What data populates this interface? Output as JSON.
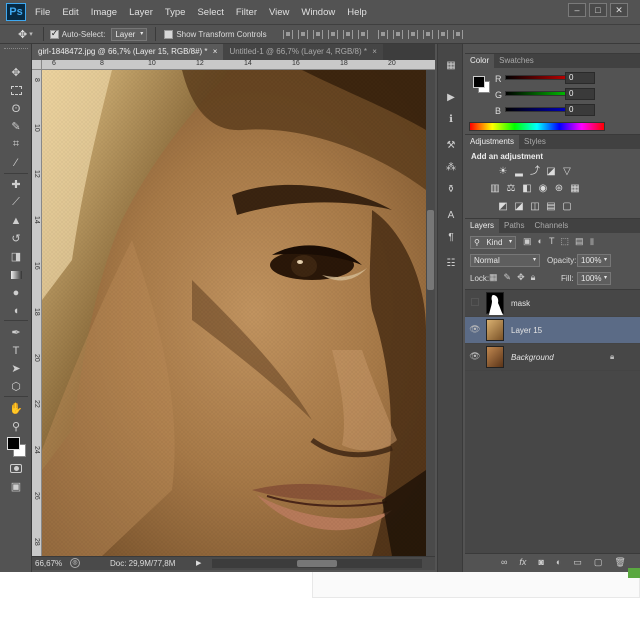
{
  "app": {
    "logo": "Ps",
    "menus": [
      "File",
      "Edit",
      "Image",
      "Layer",
      "Type",
      "Select",
      "Filter",
      "View",
      "Window",
      "Help"
    ],
    "window_controls": {
      "minimize": "–",
      "restore": "□",
      "close": "✕"
    }
  },
  "options": {
    "tool_icon": "move-tool-icon",
    "auto_select_label": "Auto-Select:",
    "auto_select_checked": true,
    "auto_select_value": "Layer",
    "show_transform_label": "Show Transform Controls",
    "show_transform_checked": false
  },
  "tabs": [
    {
      "label": "girl-1848472.jpg @ 66,7% (Layer 15, RGB/8#) *",
      "close": "×",
      "active": true
    },
    {
      "label": "Untitled-1 @ 66,7% (Layer 4, RGB/8) *",
      "close": "×",
      "active": false
    }
  ],
  "rulers": {
    "top": [
      "6",
      "8",
      "10",
      "12",
      "14",
      "16",
      "18",
      "20"
    ],
    "left": [
      "8",
      "10",
      "12",
      "14",
      "16",
      "18",
      "20",
      "22",
      "24",
      "26",
      "28"
    ]
  },
  "status": {
    "zoom": "66,67%",
    "doc": "Doc: 29,9M/77,8M"
  },
  "color_panel": {
    "tabs": [
      "Color",
      "Swatches"
    ],
    "channels": [
      {
        "label": "R",
        "value": "0"
      },
      {
        "label": "G",
        "value": "0"
      },
      {
        "label": "B",
        "value": "0"
      }
    ],
    "colors": {
      "r": "#ff0000",
      "g": "#00ff00",
      "b": "#0000ff"
    }
  },
  "adjustments_panel": {
    "tabs": [
      "Adjustments",
      "Styles"
    ],
    "heading": "Add an adjustment"
  },
  "layers_panel": {
    "tabs": [
      "Layers",
      "Paths",
      "Channels"
    ],
    "filter_kind": "Kind",
    "blend_mode": "Normal",
    "opacity_label": "Opacity:",
    "opacity_value": "100%",
    "lock_label": "Lock:",
    "fill_label": "Fill:",
    "fill_value": "100%",
    "layers": [
      {
        "name": "mask",
        "visible": false,
        "selected": false
      },
      {
        "name": "Layer 15",
        "visible": true,
        "selected": true
      },
      {
        "name": "Background",
        "visible": true,
        "selected": false,
        "locked": true
      }
    ],
    "bottom_icons": [
      "link-icon",
      "fx-icon",
      "mask-icon",
      "adjustment-icon",
      "folder-icon",
      "new-layer-icon",
      "trash-icon"
    ]
  },
  "colors": {
    "ui_bg": "#535353",
    "selection": "#5b6b86",
    "accent": "#3ea8f0"
  }
}
